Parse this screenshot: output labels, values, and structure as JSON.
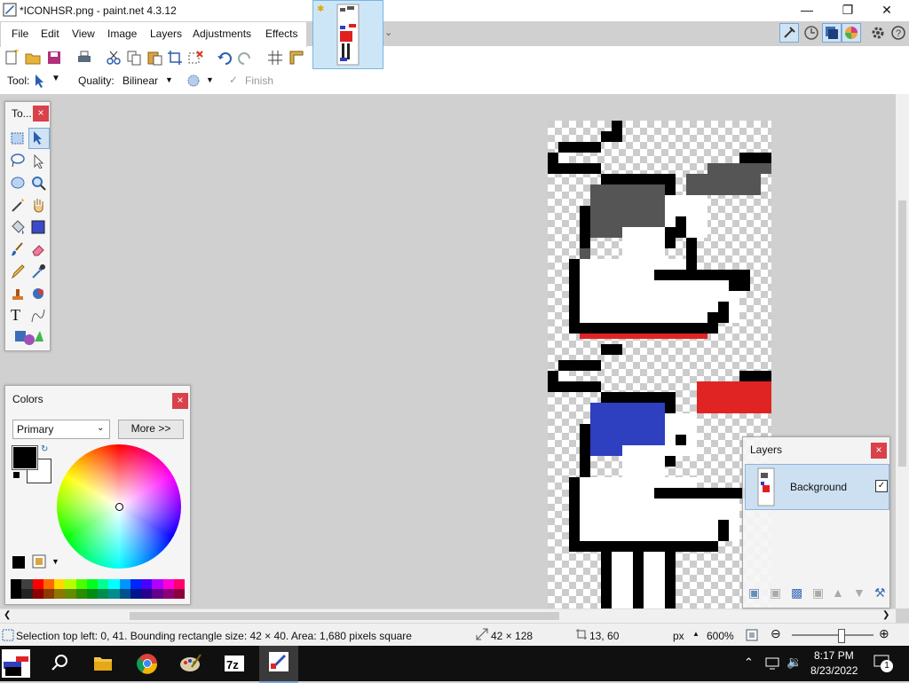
{
  "window": {
    "title": "*ICONHSR.png - paint.net 4.3.12",
    "minimize_icon": "minimize-icon",
    "maximize_icon": "maximize-icon",
    "close_icon": "close-icon"
  },
  "menu": [
    "File",
    "Edit",
    "View",
    "Image",
    "Layers",
    "Adjustments",
    "Effects"
  ],
  "toolbar2": {
    "tool_label": "Tool:",
    "quality_label": "Quality:",
    "quality_value": "Bilinear",
    "finish_label": "Finish"
  },
  "tools_panel": {
    "title": "To..."
  },
  "colors_panel": {
    "title": "Colors",
    "mode_value": "Primary",
    "more_label": "More >>",
    "primary_color": "#000000",
    "secondary_color": "#ffffff"
  },
  "layers_panel": {
    "title": "Layers",
    "layer_name": "Background",
    "layer_visible": true
  },
  "status": {
    "selection_text": "Selection top left: 0, 41. Bounding rectangle size: 42 × 40. Area: 1,680 pixels square",
    "image_size": "42 × 128",
    "cursor_pos": "13, 60",
    "units": "px",
    "zoom": "600%"
  },
  "taskbar": {
    "time": "8:17 PM",
    "date": "8/23/2022",
    "notification_count": "1"
  },
  "palette": [
    "#000000",
    "#404040",
    "#ff0000",
    "#ff6a00",
    "#ffd800",
    "#b6ff00",
    "#4cff00",
    "#00ff21",
    "#00ff90",
    "#00ffff",
    "#0094ff",
    "#0026ff",
    "#4800ff",
    "#b200ff",
    "#ff00dc",
    "#ff006e"
  ]
}
